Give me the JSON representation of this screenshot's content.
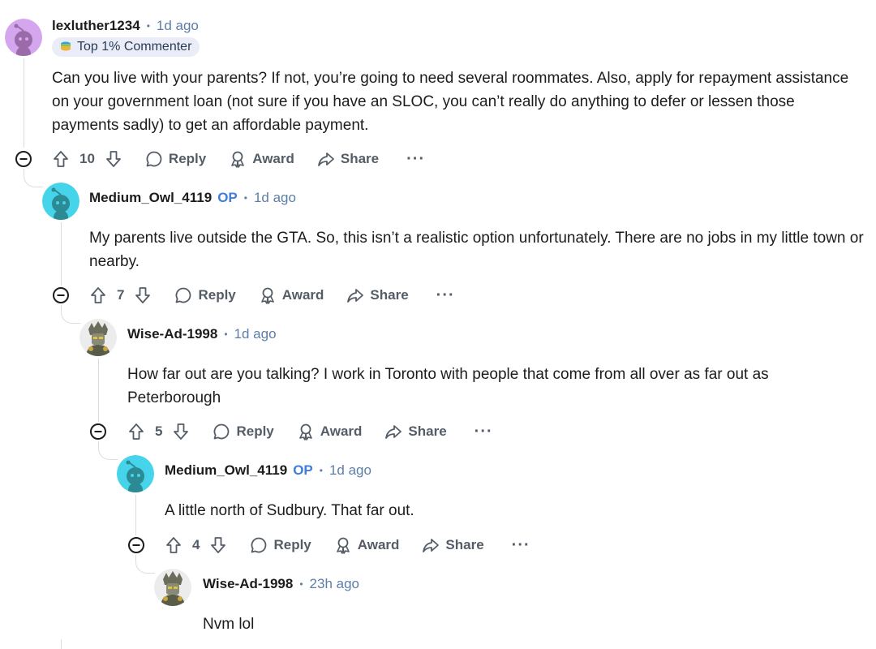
{
  "comments": [
    {
      "username": "lexluther1234",
      "op": "",
      "separator": "•",
      "time": "1d ago",
      "flair": "Top 1% Commenter",
      "body": "Can you live with your parents? If not, you’re going to need several roommates. Also, apply for repayment assistance on your government loan (not sure if you have an SLOC, you can’t really do anything to defer or lessen those payments sadly) to get an affordable payment.",
      "votes": "10",
      "avatar_color": "#d4a6ee"
    },
    {
      "username": "Medium_Owl_4119",
      "op": "OP",
      "separator": "•",
      "time": "1d ago",
      "body": "My parents live outside the GTA. So, this isn’t a realistic option unfortunately. There are no jobs in my little town or nearby.",
      "votes": "7",
      "avatar_color": "#46d4ea"
    },
    {
      "username": "Wise-Ad-1998",
      "op": "",
      "separator": "•",
      "time": "1d ago",
      "body": "How far out are you talking? I work in Toronto with people that come from all over as far out as Peterborough",
      "votes": "5",
      "avatar_color": "#e8e8e8"
    },
    {
      "username": "Medium_Owl_4119",
      "op": "OP",
      "separator": "•",
      "time": "1d ago",
      "body": "A little north of Sudbury. That far out.",
      "votes": "4",
      "avatar_color": "#46d4ea"
    },
    {
      "username": "Wise-Ad-1998",
      "op": "",
      "separator": "•",
      "time": "23h ago",
      "body": "Nvm lol",
      "avatar_color": "#e8e8e8"
    }
  ],
  "actions": {
    "reply": "Reply",
    "award": "Award",
    "share": "Share",
    "more": "···"
  },
  "icons": {
    "upvote": "arrow-up-icon",
    "downvote": "arrow-down-icon",
    "reply": "speech-bubble-icon",
    "award": "award-ribbon-icon",
    "share": "share-arrow-icon",
    "collapse": "minus-circle-icon",
    "flair": "stack-icon"
  }
}
